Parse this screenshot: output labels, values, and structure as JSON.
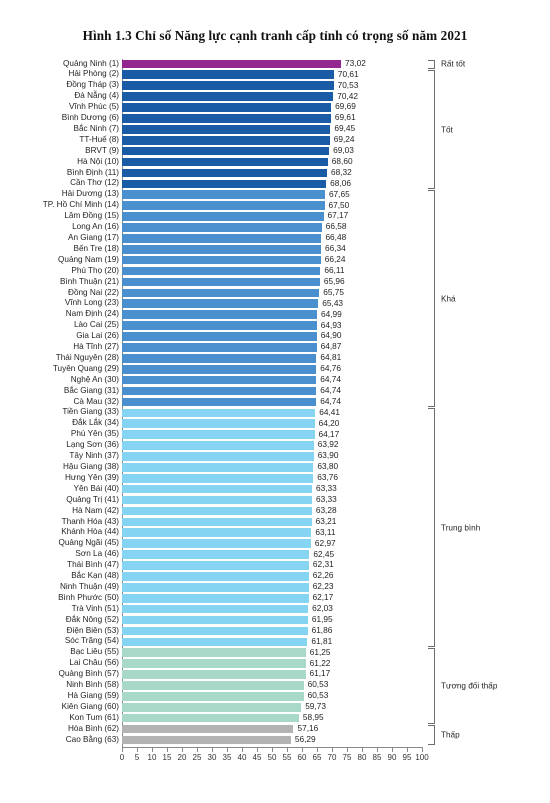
{
  "title": "Hình 1.3 Chỉ số Năng lực cạnh tranh cấp tỉnh có trọng số năm 2021",
  "axis": {
    "ticks": [
      "0",
      "5",
      "10",
      "15",
      "20",
      "25",
      "30",
      "35",
      "40",
      "45",
      "50",
      "55",
      "60",
      "65",
      "70",
      "75",
      "80",
      "85",
      "90",
      "95",
      "100"
    ],
    "min": 0,
    "max": 100
  },
  "colors": {
    "rat_tot": "#93278f",
    "tot": "#1a5ba6",
    "kha": "#4a90cf",
    "trung_binh": "#84d4f2",
    "tuong_doi_thap": "#a8d8c8",
    "thap": "#b3b3b3",
    "axis": "#8a8a8a",
    "text": "#231f20"
  },
  "groups": [
    {
      "label": "Rất tốt",
      "from": 1,
      "to": 1,
      "color": "#93278f"
    },
    {
      "label": "Tốt",
      "from": 2,
      "to": 12,
      "color": "#1a5ba6"
    },
    {
      "label": "Khá",
      "from": 13,
      "to": 32,
      "color": "#4a90cf"
    },
    {
      "label": "Trung bình",
      "from": 33,
      "to": 54,
      "color": "#84d4f2"
    },
    {
      "label": "Tương đối thấp",
      "from": 55,
      "to": 61,
      "color": "#a8d8c8"
    },
    {
      "label": "Thấp",
      "from": 62,
      "to": 63,
      "color": "#b3b3b3"
    }
  ],
  "chart_data": {
    "type": "bar",
    "orientation": "horizontal",
    "title": "Hình 1.3 Chỉ số Năng lực cạnh tranh cấp tỉnh có trọng số năm 2021",
    "xlabel": "",
    "ylabel": "",
    "xlim": [
      0,
      100
    ],
    "grid": false,
    "legend": "right-brackets",
    "categories": [
      "Quảng Ninh (1)",
      "Hải Phòng (2)",
      "Đồng Tháp (3)",
      "Đà Nẵng (4)",
      "Vĩnh Phúc (5)",
      "Bình Dương (6)",
      "Bắc Ninh (7)",
      "TT-Huế (8)",
      "BRVT (9)",
      "Hà Nội (10)",
      "Bình Định (11)",
      "Cần Thơ (12)",
      "Hải Dương (13)",
      "TP. Hồ Chí Minh (14)",
      "Lâm Đồng (15)",
      "Long An (16)",
      "An Giang (17)",
      "Bến Tre (18)",
      "Quảng Nam (19)",
      "Phú Thọ (20)",
      "Bình Thuận (21)",
      "Đồng Nai (22)",
      "Vĩnh Long (23)",
      "Nam Định (24)",
      "Lào Cai (25)",
      "Gia Lai (26)",
      "Hà Tĩnh (27)",
      "Thái Nguyên (28)",
      "Tuyên Quang (29)",
      "Nghệ An (30)",
      "Bắc Giang (31)",
      "Cà Mau (32)",
      "Tiền Giang (33)",
      "Đắk Lắk (34)",
      "Phú Yên (35)",
      "Lạng Sơn (36)",
      "Tây Ninh (37)",
      "Hậu Giang (38)",
      "Hưng Yên (39)",
      "Yên Bái (40)",
      "Quảng Trị (41)",
      "Hà Nam (42)",
      "Thanh Hóa (43)",
      "Khánh Hòa (44)",
      "Quảng Ngãi (45)",
      "Sơn La (46)",
      "Thái Bình (47)",
      "Bắc Kạn (48)",
      "Ninh Thuận (49)",
      "Bình Phước (50)",
      "Trà Vinh (51)",
      "Đắk Nông (52)",
      "Điện Biên (53)",
      "Sóc Trăng (54)",
      "Bạc Liêu (55)",
      "Lai Châu (56)",
      "Quảng Bình (57)",
      "Ninh Bình (58)",
      "Hà Giang (59)",
      "Kiên Giang (60)",
      "Kon Tum (61)",
      "Hòa Bình (62)",
      "Cao Bằng (63)"
    ],
    "values": [
      73.02,
      70.61,
      70.53,
      70.42,
      69.69,
      69.61,
      69.45,
      69.24,
      69.03,
      68.6,
      68.32,
      68.06,
      67.65,
      67.5,
      67.17,
      66.58,
      66.48,
      66.34,
      66.24,
      66.11,
      65.96,
      65.75,
      65.43,
      64.99,
      64.93,
      64.9,
      64.87,
      64.81,
      64.76,
      64.74,
      64.74,
      64.74,
      64.41,
      64.2,
      64.17,
      63.92,
      63.9,
      63.8,
      63.76,
      63.33,
      63.33,
      63.28,
      63.21,
      63.11,
      62.97,
      62.45,
      62.31,
      62.26,
      62.23,
      62.17,
      62.03,
      61.95,
      61.86,
      61.81,
      61.25,
      61.22,
      61.17,
      60.53,
      60.53,
      59.73,
      58.95,
      57.16,
      56.29
    ],
    "value_labels": [
      "73,02",
      "70,61",
      "70,53",
      "70,42",
      "69,69",
      "69,61",
      "69,45",
      "69,24",
      "69,03",
      "68,60",
      "68,32",
      "68,06",
      "67,65",
      "67,50",
      "67,17",
      "66,58",
      "66,48",
      "66,34",
      "66,24",
      "66,11",
      "65,96",
      "65,75",
      "65,43",
      "64,99",
      "64,93",
      "64,90",
      "64,87",
      "64,81",
      "64,76",
      "64,74",
      "64,74",
      "64,74",
      "64,41",
      "64,20",
      "64,17",
      "63,92",
      "63,90",
      "63,80",
      "63,76",
      "63,33",
      "63,33",
      "63,28",
      "63,21",
      "63,11",
      "62,97",
      "62,45",
      "62,31",
      "62,26",
      "62,23",
      "62,17",
      "62,03",
      "61,95",
      "61,86",
      "61,81",
      "61,25",
      "61,22",
      "61,17",
      "60,53",
      "60,53",
      "59,73",
      "58,95",
      "57,16",
      "56,29"
    ]
  }
}
